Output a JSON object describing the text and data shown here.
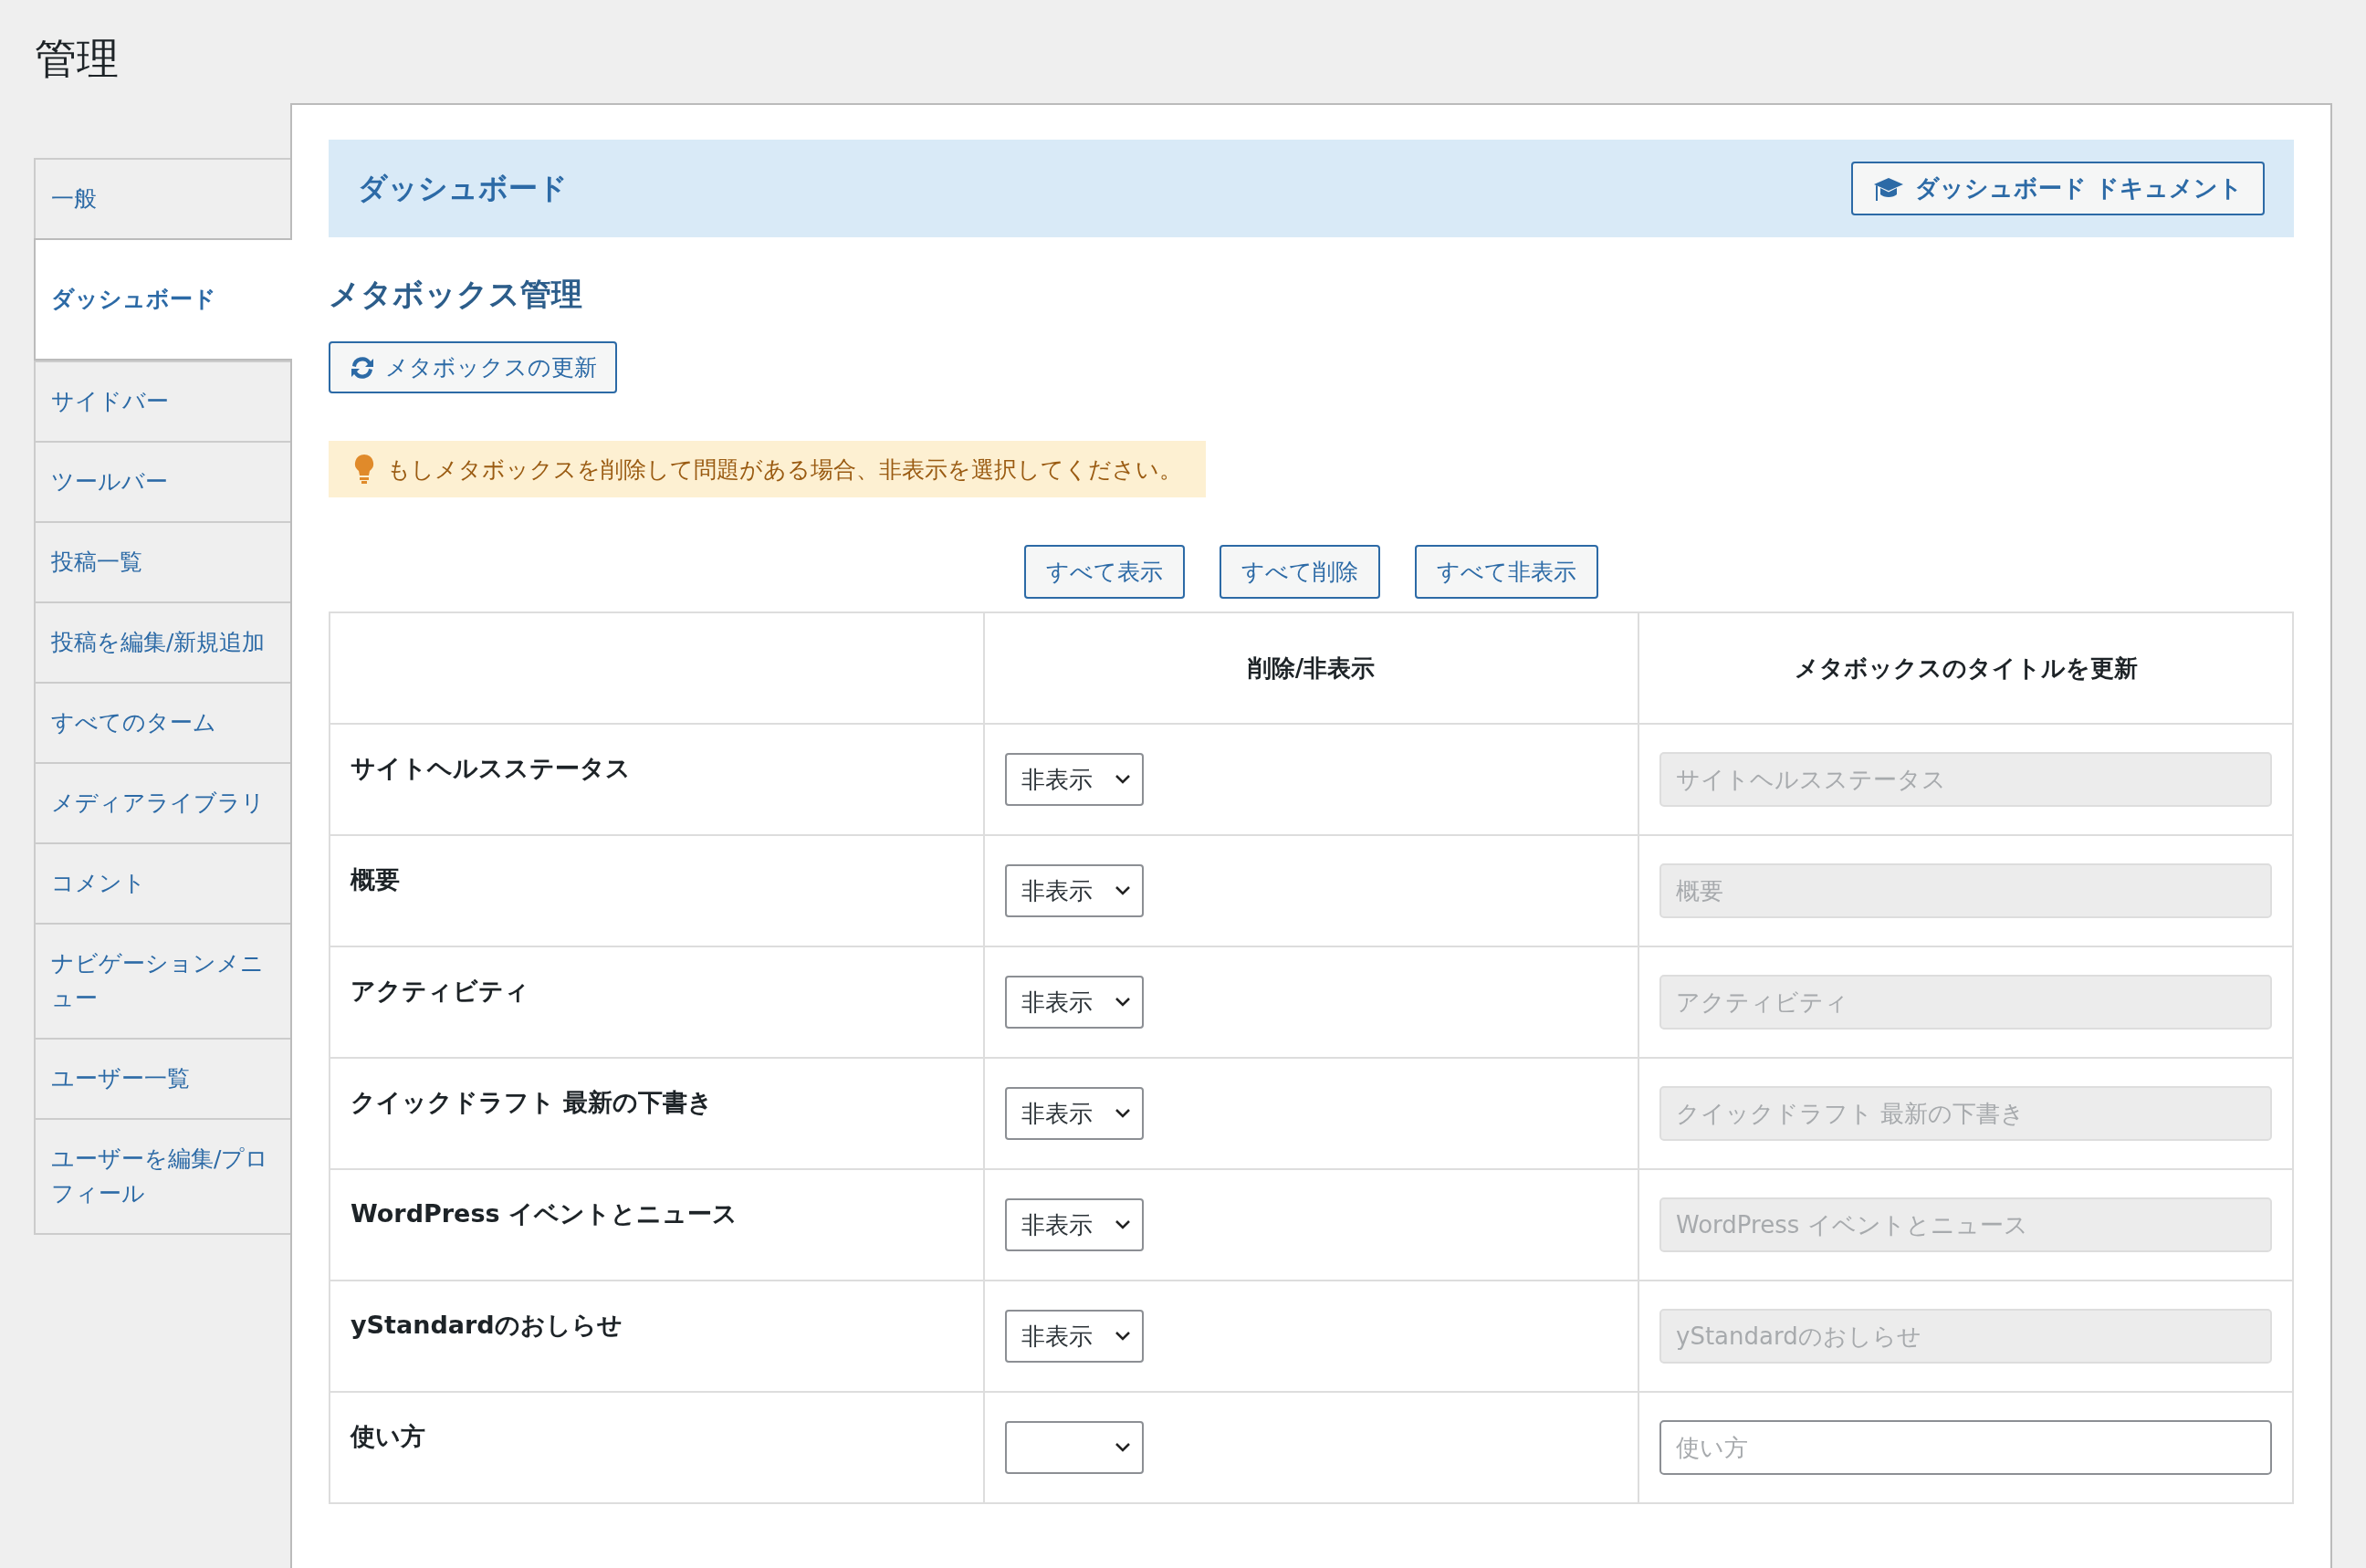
{
  "page_title": "管理",
  "sidebar": {
    "items": [
      {
        "label": "一般",
        "selected": false
      },
      {
        "label": "ダッシュボード",
        "selected": true
      },
      {
        "label": "サイドバー",
        "selected": false
      },
      {
        "label": "ツールバー",
        "selected": false
      },
      {
        "label": "投稿一覧",
        "selected": false
      },
      {
        "label": "投稿を編集/新規追加",
        "selected": false
      },
      {
        "label": "すべてのターム",
        "selected": false
      },
      {
        "label": "メディアライブラリ",
        "selected": false
      },
      {
        "label": "コメント",
        "selected": false
      },
      {
        "label": "ナビゲーションメニュー",
        "selected": false
      },
      {
        "label": "ユーザー一覧",
        "selected": false
      },
      {
        "label": "ユーザーを編集/プロフィール",
        "selected": false
      }
    ]
  },
  "section": {
    "title": "ダッシュボード",
    "doc_button": "ダッシュボード ドキュメント"
  },
  "heading": "メタボックス管理",
  "refresh_button": "メタボックスの更新",
  "notice": "もしメタボックスを削除して問題がある場合、非表示を選択してください。",
  "bulk_buttons": [
    "すべて表示",
    "すべて削除",
    "すべて非表示"
  ],
  "table": {
    "columns": [
      "削除/非表示",
      "メタボックスのタイトルを更新"
    ],
    "rows": [
      {
        "name": "サイトヘルスステータス",
        "action": "非表示",
        "placeholder": "サイトヘルスステータス",
        "disabled": true
      },
      {
        "name": "概要",
        "action": "非表示",
        "placeholder": "概要",
        "disabled": true
      },
      {
        "name": "アクティビティ",
        "action": "非表示",
        "placeholder": "アクティビティ",
        "disabled": true
      },
      {
        "name": "クイックドラフト 最新の下書き",
        "action": "非表示",
        "placeholder": "クイックドラフト 最新の下書き",
        "disabled": true
      },
      {
        "name": "WordPress イベントとニュース",
        "action": "非表示",
        "placeholder": "WordPress イベントとニュース",
        "disabled": true
      },
      {
        "name": "yStandardのおしらせ",
        "action": "非表示",
        "placeholder": "yStandardのおしらせ",
        "disabled": true
      },
      {
        "name": "使い方",
        "placeholder": "使い方",
        "disabled": false
      }
    ]
  }
}
